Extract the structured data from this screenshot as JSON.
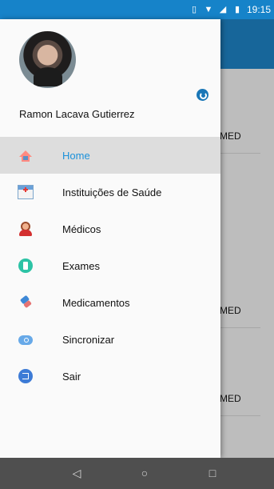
{
  "status_bar": {
    "time": "19:15",
    "icons": [
      "vibrate-icon",
      "wifi-icon",
      "signal-icon",
      "battery-icon"
    ]
  },
  "background": {
    "visible_labels": [
      "MED",
      "MED",
      "MED"
    ]
  },
  "drawer": {
    "user_name": "Ramon Lacava Gutierrez",
    "menu_items": [
      {
        "label": "Home",
        "icon": "home-icon",
        "active": true
      },
      {
        "label": "Instituições de Saúde",
        "icon": "hospital-icon",
        "active": false
      },
      {
        "label": "Médicos",
        "icon": "doctor-icon",
        "active": false
      },
      {
        "label": "Exames",
        "icon": "exam-icon",
        "active": false
      },
      {
        "label": "Medicamentos",
        "icon": "medicine-icon",
        "active": false
      },
      {
        "label": "Sincronizar",
        "icon": "sync-icon",
        "active": false
      },
      {
        "label": "Sair",
        "icon": "exit-icon",
        "active": false
      }
    ]
  },
  "navigation_bar": {
    "buttons": [
      "back-icon",
      "home-nav-icon",
      "recent-apps-icon"
    ]
  },
  "colors": {
    "status_bar": "#1683c9",
    "app_bar": "#17669a",
    "active_menu_text": "#1b91da",
    "active_menu_bg": "#dddddd"
  }
}
